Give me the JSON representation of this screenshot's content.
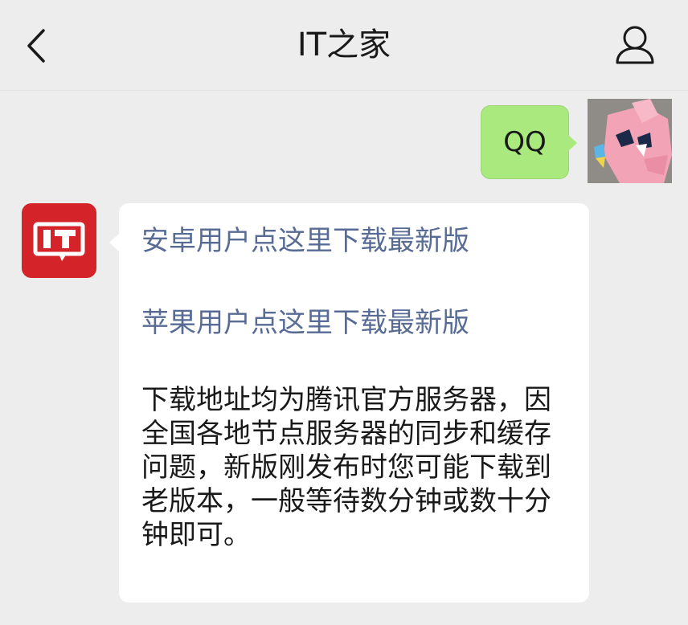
{
  "header": {
    "title": "IT之家",
    "back_icon": "chevron-left-icon",
    "profile_icon": "person-icon"
  },
  "messages": {
    "sent": {
      "text": "QQ",
      "bubble_color": "#a9e97d"
    },
    "received": {
      "avatar_text": "IT",
      "avatar_color": "#d5232a",
      "android_link": "安卓用户点这里下载最新版",
      "apple_link": "苹果用户点这里下载最新版",
      "link_color": "#576b95",
      "notice": "下载地址均为腾讯官方服务器，因全国各地节点服务器的同步和缓存问题，新版刚发布时您可能下载到老版本，一般等待数分钟或数十分钟即可。"
    }
  }
}
